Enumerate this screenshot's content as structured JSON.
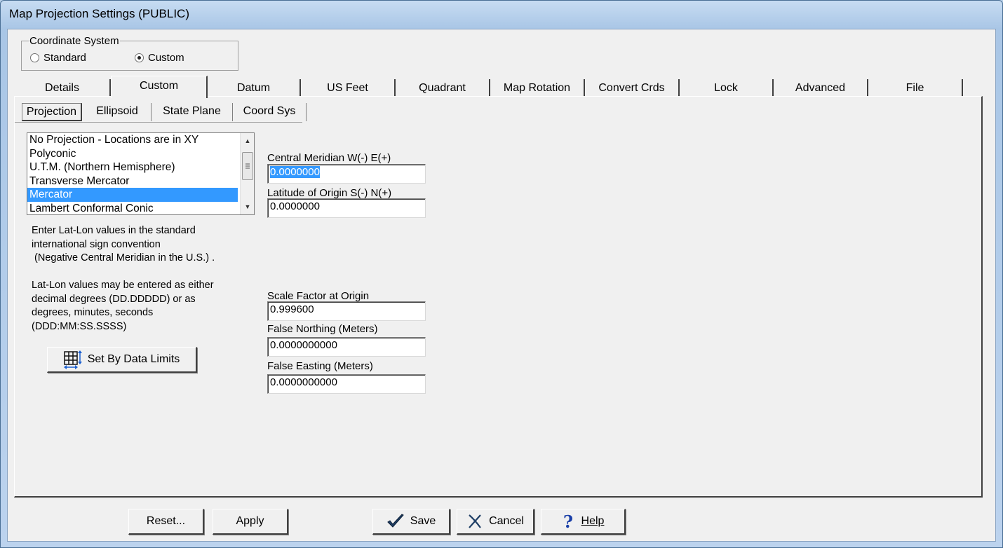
{
  "window": {
    "title": "Map Projection Settings (PUBLIC)"
  },
  "coordinate_system": {
    "legend": "Coordinate System",
    "options": [
      {
        "label": "Standard",
        "checked": false
      },
      {
        "label": "Custom",
        "checked": true
      }
    ]
  },
  "tabs": [
    {
      "label": "Details",
      "active": false
    },
    {
      "label": "Custom",
      "active": true
    },
    {
      "label": "Datum",
      "active": false
    },
    {
      "label": "US Feet",
      "active": false
    },
    {
      "label": "Quadrant",
      "active": false
    },
    {
      "label": "Map Rotation",
      "active": false
    },
    {
      "label": "Convert Crds",
      "active": false
    },
    {
      "label": "Lock",
      "active": false
    },
    {
      "label": "Advanced",
      "active": false
    },
    {
      "label": "File",
      "active": false
    }
  ],
  "subtabs": [
    {
      "label": "Projection",
      "active": true
    },
    {
      "label": "Ellipsoid",
      "active": false
    },
    {
      "label": "State Plane",
      "active": false
    },
    {
      "label": "Coord Sys",
      "active": false
    }
  ],
  "projection_list": {
    "items": [
      "No Projection - Locations are in XY",
      "Polyconic",
      "U.T.M. (Northern Hemisphere)",
      "Transverse Mercator",
      "Mercator",
      "Lambert Conformal Conic"
    ],
    "selected_index": 4
  },
  "info": {
    "sign_convention": "Enter Lat-Lon values in the standard\ninternational sign convention\n (Negative Central Meridian in the U.S.) .",
    "formats": "Lat-Lon values may be entered as either\ndecimal degrees (DD.DDDDD) or as\ndegrees, minutes, seconds\n(DDD:MM:SS.SSSS)"
  },
  "set_by_data_limits": {
    "label": "Set By Data Limits",
    "icon": "grid-extent-icon"
  },
  "fields": {
    "central_meridian": {
      "label": "Central Meridian W(-) E(+)",
      "value": "0.0000000"
    },
    "latitude_origin": {
      "label": "Latitude of Origin S(-) N(+)",
      "value": "0.0000000"
    },
    "scale_factor": {
      "label": "Scale Factor at Origin",
      "value": "0.999600"
    },
    "false_northing": {
      "label": "False Northing  (Meters)",
      "value": "0.0000000000"
    },
    "false_easting": {
      "label": "False Easting  (Meters)",
      "value": "0.0000000000"
    }
  },
  "buttons": {
    "reset": "Reset...",
    "apply": "Apply",
    "save": "Save",
    "cancel": "Cancel",
    "help": "Help"
  },
  "colors": {
    "selection": "#3399ff",
    "face": "#f0f0f0",
    "frame": "#b9d1ea"
  }
}
